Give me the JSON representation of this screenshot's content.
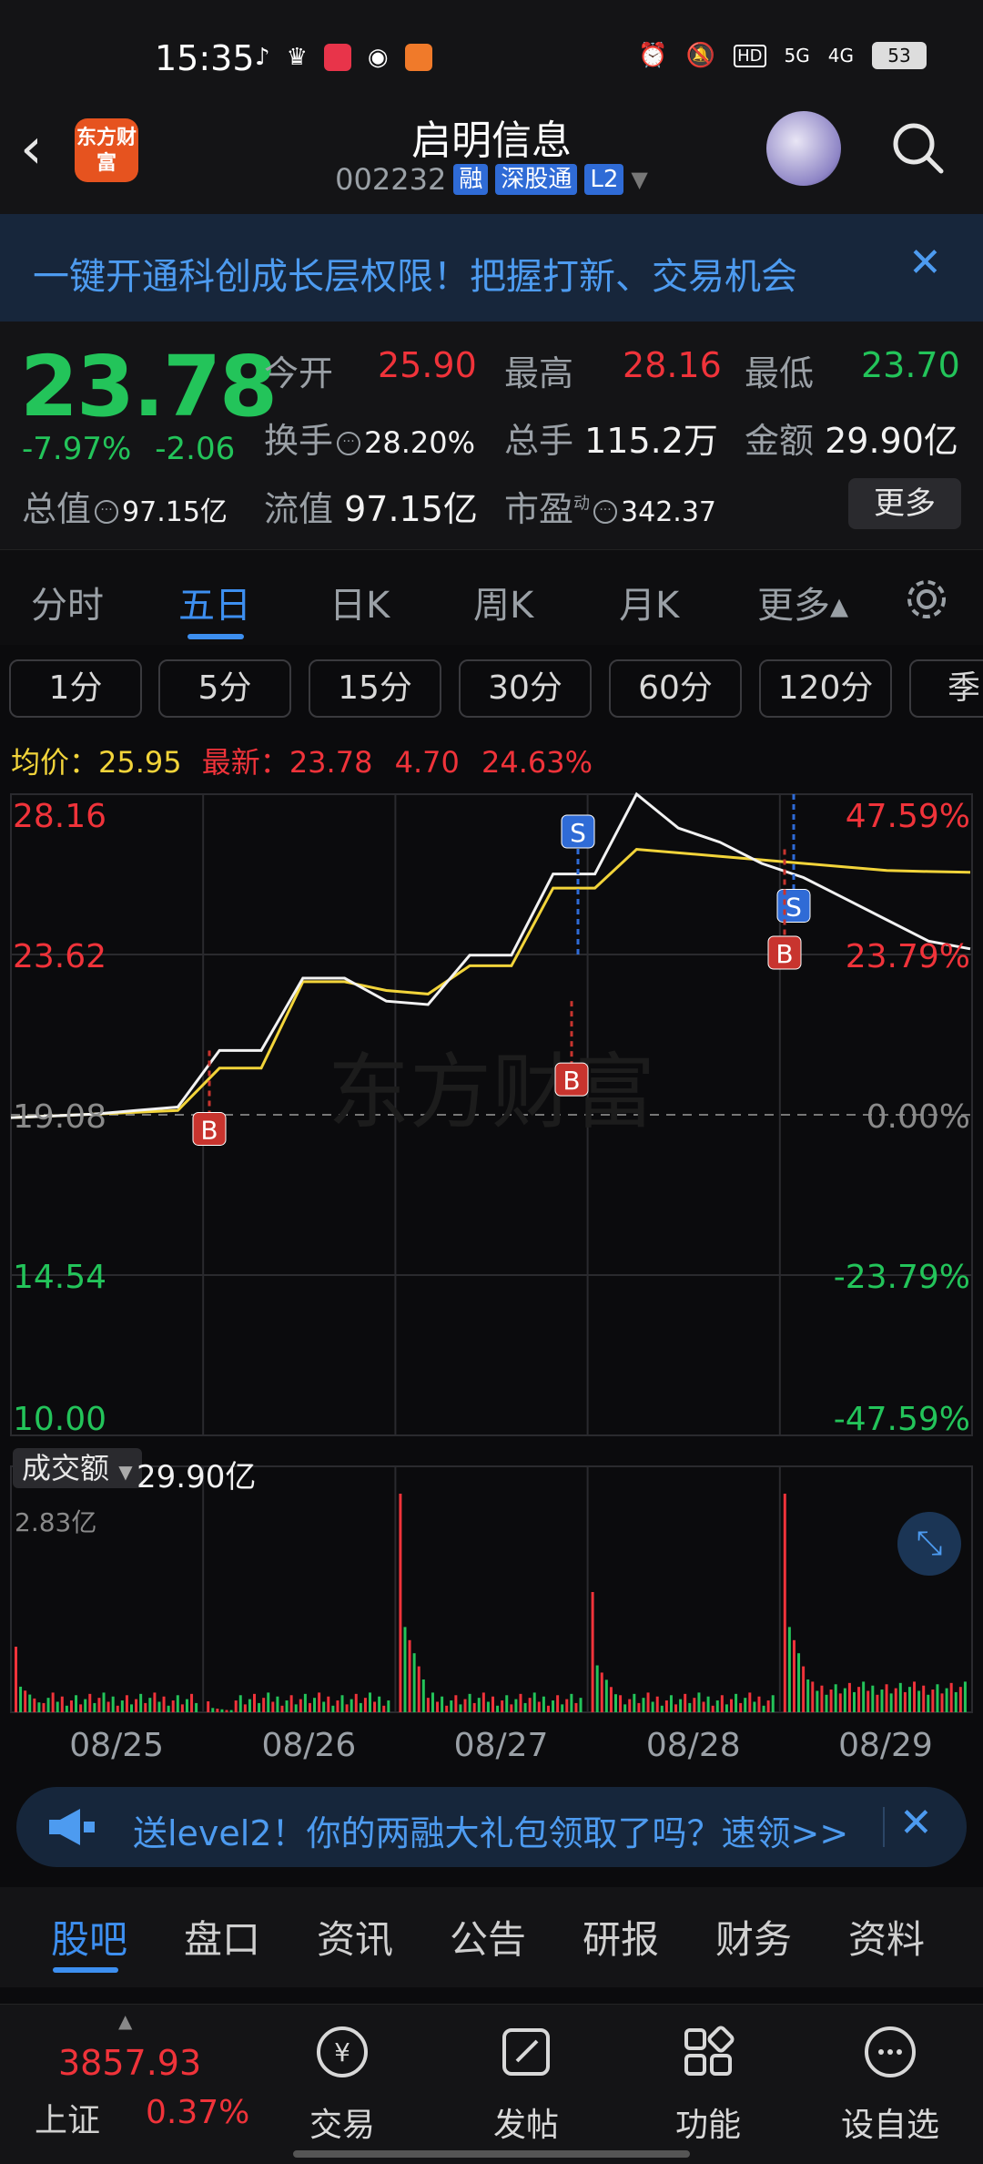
{
  "status_bar": {
    "time": "15:35",
    "battery": "53",
    "network": [
      "HD",
      "5G",
      "4G"
    ]
  },
  "header": {
    "logo_text": "东方财富",
    "stock_name": "启明信息",
    "stock_code": "002232",
    "tags": [
      "融",
      "深股通",
      "L2"
    ]
  },
  "banner": {
    "text": "一键开通科创成长层权限！把握打新、交易机会"
  },
  "quote": {
    "price": "23.78",
    "change_pct": "-7.97%",
    "change_amt": "-2.06",
    "open_label": "今开",
    "open": "25.90",
    "high_label": "最高",
    "high": "28.16",
    "low_label": "最低",
    "low": "23.70",
    "turnover_label": "换手",
    "turnover": "28.20%",
    "volume_label": "总手",
    "volume": "115.2万",
    "amount_label": "金额",
    "amount": "29.90亿",
    "mktcap_label": "总值",
    "mktcap": "97.15亿",
    "float_label": "流值",
    "float": "97.15亿",
    "pe_label": "市盈",
    "pe_sup": "动",
    "pe": "342.37",
    "more": "更多"
  },
  "chart_tabs": [
    "分时",
    "五日",
    "日K",
    "周K",
    "月K",
    "更多▴"
  ],
  "periods": [
    "1分",
    "5分",
    "15分",
    "30分",
    "60分",
    "120分",
    "季"
  ],
  "legend": {
    "avg_label": "均价：",
    "avg": "25.95",
    "latest_label": "最新：",
    "latest": "23.78",
    "latest_chg": "4.70",
    "latest_pct": "24.63%"
  },
  "chart_data": {
    "type": "line",
    "y_left_ticks": [
      "28.16",
      "23.62",
      "19.08",
      "14.54",
      "10.00"
    ],
    "y_right_ticks": [
      "47.59%",
      "23.79%",
      "0.00%",
      "-23.79%",
      "-47.59%"
    ],
    "ylim": [
      10.0,
      28.16
    ],
    "x_labels": [
      "08/25",
      "08/26",
      "08/27",
      "08/28",
      "08/29"
    ],
    "series": [
      {
        "values": [
          19.0,
          19.05,
          19.1,
          19.2,
          19.3,
          20.9,
          20.9,
          22.95,
          22.95,
          22.3,
          22.2,
          23.6,
          23.6,
          25.9,
          25.9,
          28.16,
          27.2,
          26.8,
          26.2,
          25.8,
          25.2,
          24.6,
          24.0,
          23.78
        ]
      },
      {
        "name": "均价",
        "values": [
          19.0,
          19.05,
          19.1,
          19.15,
          19.2,
          20.4,
          20.4,
          22.85,
          22.85,
          22.6,
          22.5,
          23.3,
          23.3,
          25.5,
          25.5,
          26.6,
          26.5,
          26.4,
          26.3,
          26.2,
          26.1,
          26.0,
          25.97,
          25.95
        ]
      }
    ],
    "signals": [
      {
        "label": "B",
        "day": "08/25"
      },
      {
        "label": "B",
        "day": "08/27"
      },
      {
        "label": "S",
        "day": "08/27"
      },
      {
        "label": "S",
        "day": "08/29"
      },
      {
        "label": "B",
        "day": "08/29"
      }
    ],
    "watermark": "东方财富",
    "volume_label": "成交额",
    "volume_total": "29.90亿",
    "volume_max": "2.83亿"
  },
  "promo": {
    "text": "送level2！你的两融大礼包领取了吗？速领>>"
  },
  "bottom_tabs": [
    "股吧",
    "盘口",
    "资讯",
    "公告",
    "研报",
    "财务",
    "资料"
  ],
  "bottom_nav": {
    "index_value": "3857.93",
    "index_name": "上证",
    "index_pct": "0.37%",
    "items": [
      {
        "label": "交易",
        "icon": "yen-icon"
      },
      {
        "label": "发帖",
        "icon": "edit-icon"
      },
      {
        "label": "功能",
        "icon": "grid-icon"
      },
      {
        "label": "设自选",
        "icon": "more-icon"
      }
    ]
  },
  "colors": {
    "up": "#f0333a",
    "down": "#23c45a",
    "accent": "#3d8ff0",
    "avg": "#f2d43a"
  }
}
